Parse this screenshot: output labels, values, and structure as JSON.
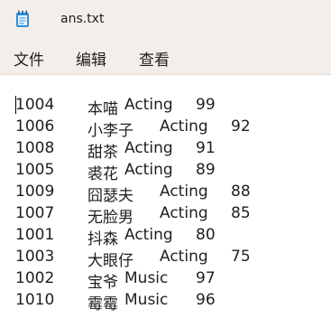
{
  "window": {
    "title": "ans.txt",
    "icon": "notepad-icon"
  },
  "menu": {
    "file": "文件",
    "edit": "编辑",
    "view": "查看"
  },
  "lines": [
    {
      "id": "1004",
      "name": "本喵",
      "category": "Acting",
      "score": "99"
    },
    {
      "id": "1006",
      "name": "小李子",
      "category": "Acting",
      "score": "92"
    },
    {
      "id": "1008",
      "name": "甜茶",
      "category": "Acting",
      "score": "91"
    },
    {
      "id": "1005",
      "name": "裘花",
      "category": "Acting",
      "score": "89"
    },
    {
      "id": "1009",
      "name": "囧瑟夫",
      "category": "Acting",
      "score": "88"
    },
    {
      "id": "1007",
      "name": "无脸男",
      "category": "Acting",
      "score": "85"
    },
    {
      "id": "1001",
      "name": "抖森",
      "category": "Acting",
      "score": "80"
    },
    {
      "id": "1003",
      "name": "大眼仔",
      "category": "Acting",
      "score": "75"
    },
    {
      "id": "1002",
      "name": "宝爷",
      "category": "Music",
      "score": "97"
    },
    {
      "id": "1010",
      "name": "霉霉",
      "category": "Music",
      "score": "96"
    }
  ]
}
